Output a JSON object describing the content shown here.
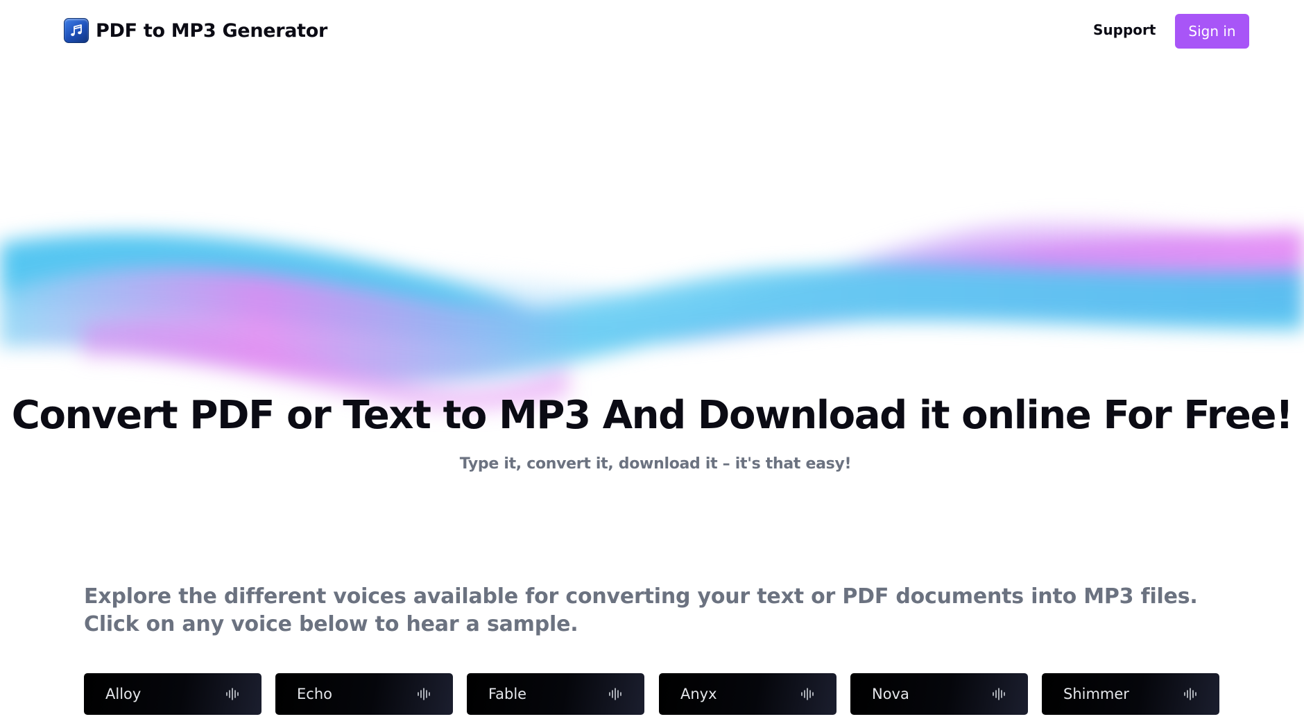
{
  "header": {
    "brand_name": "PDF to MP3 Generator",
    "logo_icon": "music-note-app-icon",
    "support_label": "Support",
    "signin_label": "Sign in"
  },
  "hero": {
    "title": "Convert PDF or Text to MP3 And Download it online For Free!",
    "subtitle": "Type it, convert it, download it – it's that easy!"
  },
  "voices": {
    "intro": "Explore the different voices available for converting your text or PDF documents into MP3 files. Click on any voice below to hear a sample.",
    "items": [
      {
        "label": "Alloy",
        "icon": "audio-wave-icon"
      },
      {
        "label": "Echo",
        "icon": "audio-wave-icon"
      },
      {
        "label": "Fable",
        "icon": "audio-wave-icon"
      },
      {
        "label": "Anyx",
        "icon": "audio-wave-icon"
      },
      {
        "label": "Nova",
        "icon": "audio-wave-icon"
      },
      {
        "label": "Shimmer",
        "icon": "audio-wave-icon"
      }
    ]
  },
  "colors": {
    "accent": "#a855f7",
    "text_dark": "#0b0b14",
    "text_muted": "#6b7280",
    "wave_cyan": "#4cc3f0",
    "wave_purple": "#c77dff",
    "card_bg": "#05060b"
  }
}
